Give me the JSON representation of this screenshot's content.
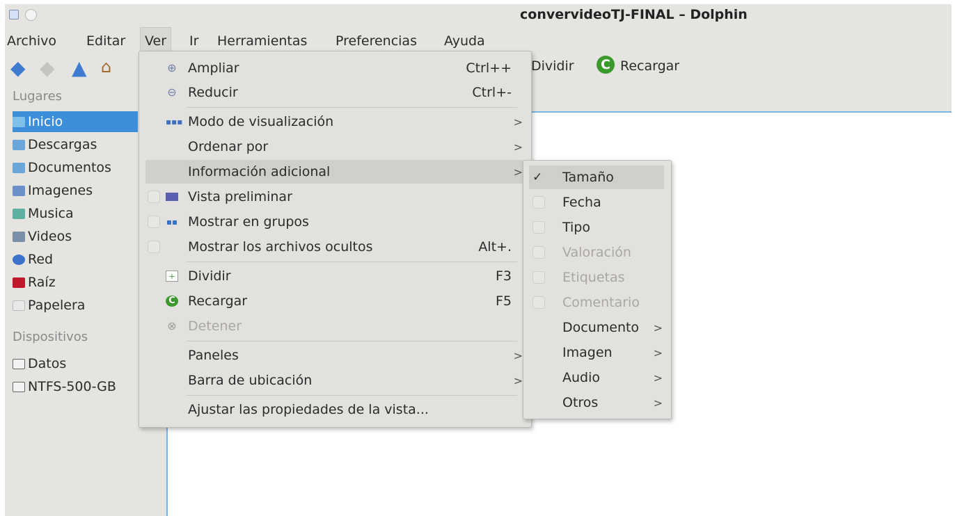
{
  "window": {
    "title": "convervideoTJ-FINAL – Dolphin"
  },
  "menubar": [
    "Archivo",
    "Editar",
    "Ver",
    "Ir",
    "Herramientas",
    "Preferencias",
    "Ayuda"
  ],
  "toolbar": {
    "dividir": "Dividir",
    "recargar": "Recargar"
  },
  "sidebar": {
    "lugares_title": "Lugares",
    "places": [
      "Inicio",
      "Descargas",
      "Documentos",
      "Imagenes",
      "Musica",
      "Videos",
      "Red",
      "Raíz",
      "Papelera"
    ],
    "dispositivos_title": "Dispositivos",
    "devices": [
      "Datos",
      "NTFS-500-GB"
    ]
  },
  "ver_menu": {
    "ampliar": "Ampliar",
    "ampliar_sc": "Ctrl++",
    "reducir": "Reducir",
    "reducir_sc": "Ctrl+-",
    "modo": "Modo de visualización",
    "ordenar": "Ordenar por",
    "info": "Información adicional",
    "vista": "Vista preliminar",
    "grupos": "Mostrar en grupos",
    "ocultos": "Mostrar los archivos ocultos",
    "ocultos_sc": "Alt+.",
    "dividir": "Dividir",
    "dividir_sc": "F3",
    "recargar": "Recargar",
    "recargar_sc": "F5",
    "detener": "Detener",
    "paneles": "Paneles",
    "barra": "Barra de ubicación",
    "ajustar": "Ajustar las propiedades de la vista..."
  },
  "info_submenu": {
    "tamano": "Tamaño",
    "fecha": "Fecha",
    "tipo": "Tipo",
    "valoracion": "Valoración",
    "etiquetas": "Etiquetas",
    "comentario": "Comentario",
    "documento": "Documento",
    "imagen": "Imagen",
    "audio": "Audio",
    "otros": "Otros"
  },
  "colors": {
    "selection": "#3d8fdb",
    "accent_border": "#7ab3e8"
  }
}
